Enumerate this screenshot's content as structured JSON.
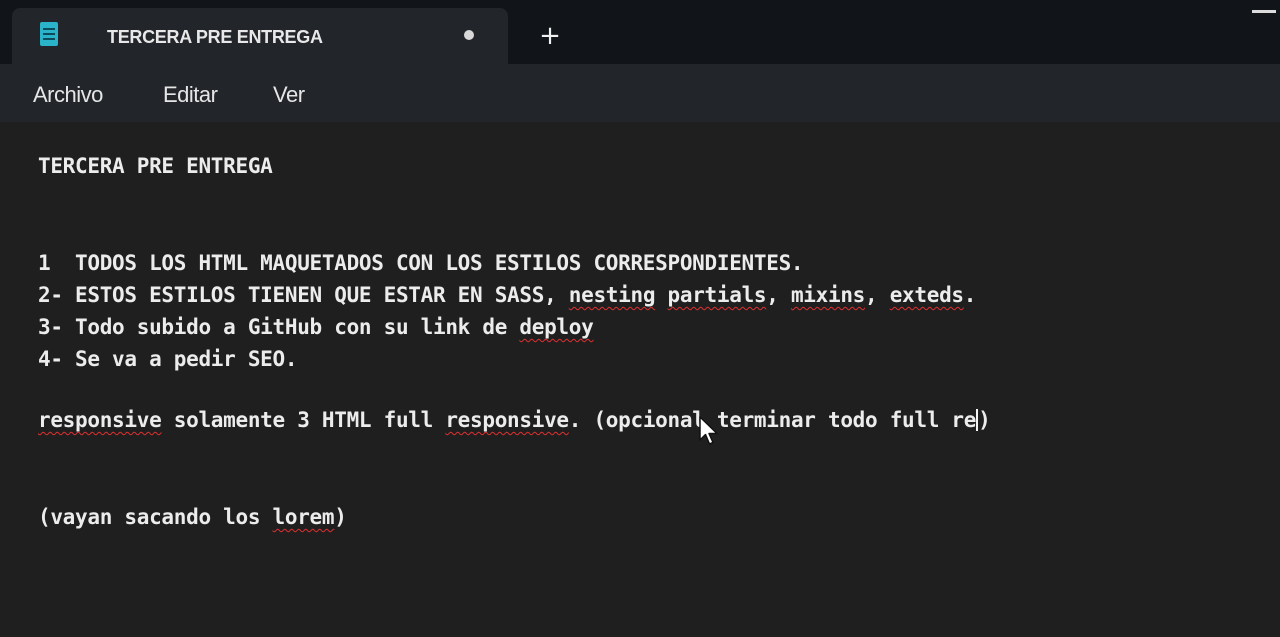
{
  "window": {
    "tab_title": "TERCERA PRE ENTREGA",
    "new_tab_label": "+",
    "app_icon": "notepad-icon"
  },
  "menu": {
    "archivo": "Archivo",
    "editar": "Editar",
    "ver": "Ver"
  },
  "document": {
    "title_line": "TERCERA PRE ENTREGA",
    "item1": "1  TODOS LOS HTML MAQUETADOS CON LOS ESTILOS CORRESPONDIENTES.",
    "item2_prefix": "2- ESTOS ESTILOS TIENEN QUE ESTAR EN SASS, ",
    "item2_nesting": "nesting",
    "item2_sp1": " ",
    "item2_partials": "partials",
    "item2_comma1": ", ",
    "item2_mixins": "mixins",
    "item2_comma2": ", ",
    "item2_exteds": "exteds",
    "item2_end": ".",
    "item3_prefix": "3- Todo subido a GitHub con su link de ",
    "item3_deploy": "deploy",
    "item4": "4- Se va a pedir SEO.",
    "resp_word1": "responsive",
    "resp_mid": " solamente 3 HTML full ",
    "resp_word2": "responsive",
    "resp_rest_a": ". (opcional terminar todo full re",
    "resp_rest_b": ")",
    "vayan_prefix": "(vayan sacando los ",
    "vayan_lorem": "lorem",
    "vayan_end": ")"
  }
}
